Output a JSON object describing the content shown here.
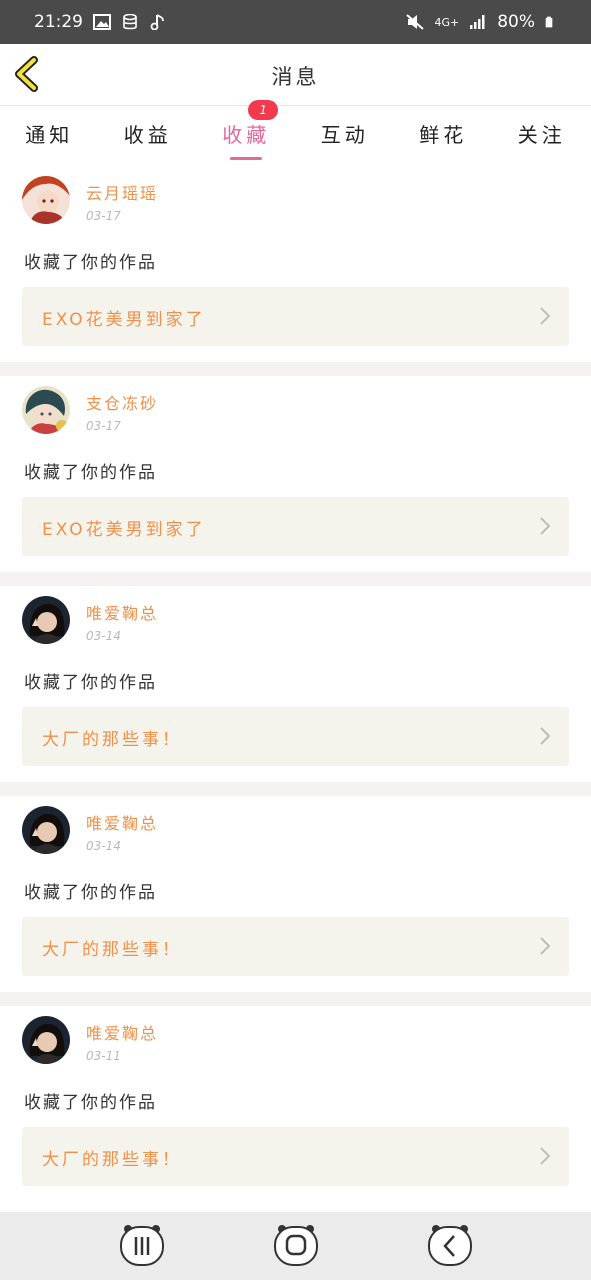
{
  "status_bar": {
    "time": "21:29",
    "network": "4G+",
    "battery": "80%",
    "icons": [
      "image-icon",
      "database-icon",
      "music-note-icon",
      "mute-icon",
      "signal-icon",
      "battery-icon"
    ]
  },
  "header": {
    "title": "消息",
    "back_icon": "chevron-left-icon",
    "accent": "#f2e23a"
  },
  "tabs": [
    {
      "label": "通知",
      "active": false
    },
    {
      "label": "收益",
      "active": false
    },
    {
      "label": "收藏",
      "active": true,
      "badge": "1"
    },
    {
      "label": "互动",
      "active": false
    },
    {
      "label": "鲜花",
      "active": false
    },
    {
      "label": "关注",
      "active": false
    }
  ],
  "colors": {
    "active_tab": "#e2679a",
    "username": "#f0904a",
    "badge": "#f23a4f",
    "card_bg": "#f5f4ec"
  },
  "messages": [
    {
      "user": "云月瑶瑶",
      "date": "03-17",
      "action": "收藏了你的作品",
      "work": "EXO花美男到家了"
    },
    {
      "user": "支仓冻砂",
      "date": "03-17",
      "action": "收藏了你的作品",
      "work": "EXO花美男到家了"
    },
    {
      "user": "唯爱鞠总",
      "date": "03-14",
      "action": "收藏了你的作品",
      "work": "大厂的那些事！"
    },
    {
      "user": "唯爱鞠总",
      "date": "03-14",
      "action": "收藏了你的作品",
      "work": "大厂的那些事！"
    },
    {
      "user": "唯爱鞠总",
      "date": "03-11",
      "action": "收藏了你的作品",
      "work": "大厂的那些事！"
    }
  ],
  "nav_bar": {
    "buttons": [
      "recent-apps-icon",
      "home-icon",
      "back-icon"
    ]
  }
}
